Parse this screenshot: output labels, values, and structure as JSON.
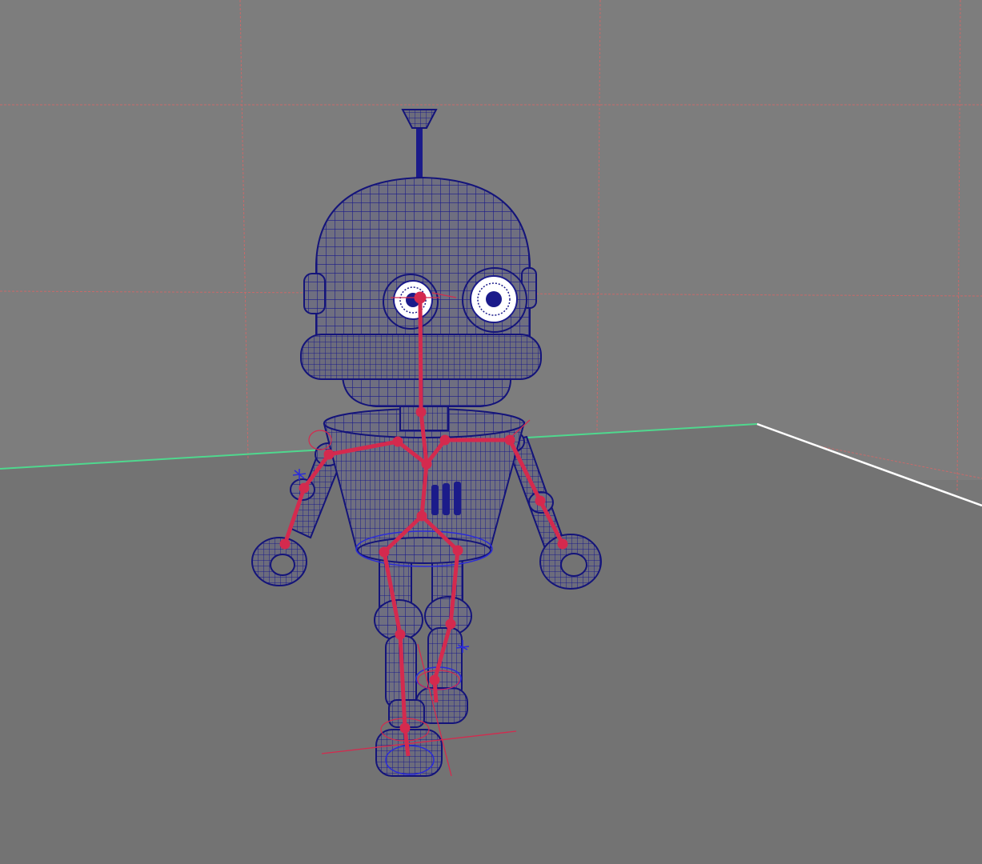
{
  "viewport": {
    "kind": "3d-perspective-viewport",
    "display_mode": "wireframe-on-shaded",
    "background_wall_color": "#7d7d7d",
    "floor_color": "#737373",
    "grid_line_color": "#c76a6a",
    "x_axis_color": "#ffffff",
    "z_axis_color": "#4fd88e"
  },
  "scene": {
    "character": {
      "name": "robot",
      "wireframe_color": "#14147a",
      "shaded_color": "#6f6f80",
      "eye_white_color": "#ffffff"
    },
    "skeleton": {
      "joint_color": "#d42a4e",
      "control_curve_color": "#2b2bd9",
      "ground_locator_color": "#c8283c",
      "joints": [
        "head",
        "left-eye",
        "neck",
        "chest",
        "spine",
        "hips",
        "left-shoulder",
        "left-elbow",
        "left-wrist",
        "right-shoulder",
        "right-elbow",
        "right-wrist",
        "left-hip",
        "left-knee",
        "left-ankle",
        "right-hip",
        "right-knee",
        "right-ankle"
      ]
    }
  }
}
